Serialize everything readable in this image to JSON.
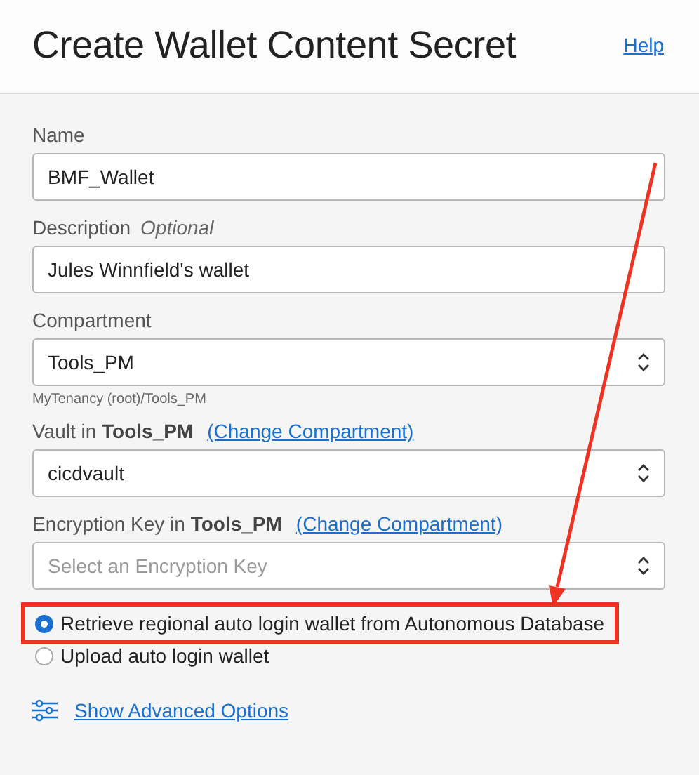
{
  "header": {
    "title": "Create Wallet Content Secret",
    "help_link": "Help"
  },
  "fields": [
    {
      "kind": "text",
      "label": "Name",
      "value": "BMF_Wallet"
    },
    {
      "kind": "text",
      "label": "Description",
      "optional": "Optional",
      "value": "Jules Winnfield's wallet"
    },
    {
      "kind": "select",
      "label": "Compartment",
      "value": "Tools_PM",
      "hint": "MyTenancy (root)/Tools_PM"
    },
    {
      "kind": "select",
      "label": "Vault in **Tools_PM**",
      "link": "(Change Compartment)",
      "value": "cicdvault"
    },
    {
      "kind": "select",
      "label": "Encryption Key in **Tools_PM**",
      "link": "(Change Compartment)",
      "placeholder": "Select an Encryption Key"
    }
  ],
  "radios": [
    {
      "label": "Retrieve regional auto login wallet from Autonomous Database",
      "selected": true,
      "highlighted": true
    },
    {
      "label": "Upload auto login wallet",
      "selected": false,
      "highlighted": false
    }
  ],
  "advanced_link": "Show Advanced Options"
}
